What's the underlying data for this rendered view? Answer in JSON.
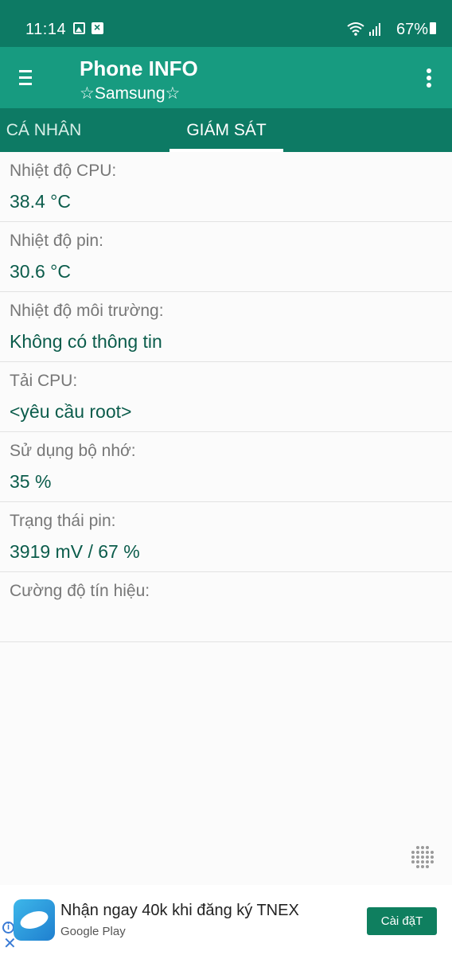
{
  "status_bar": {
    "time": "11:14",
    "battery_percent": "67%",
    "icons": [
      "image-icon",
      "x-notification-icon",
      "wifi-icon",
      "signal-icon",
      "battery-icon"
    ]
  },
  "app_bar": {
    "title": "Phone INFO",
    "subtitle": "☆Samsung☆"
  },
  "tabs": [
    {
      "label": "CÁ NHÂN"
    },
    {
      "label": "GIÁM SÁT",
      "active": true
    }
  ],
  "rows": [
    {
      "label": "Nhiệt độ CPU:",
      "value": "38.4 °C"
    },
    {
      "label": "Nhiệt độ pin:",
      "value": "30.6 °C"
    },
    {
      "label": "Nhiệt độ môi trường:",
      "value": "Không có thông tin"
    },
    {
      "label": "Tải CPU:",
      "value": "<yêu cầu root>"
    },
    {
      "label": "Sử dụng bộ nhớ:",
      "value": "35 %"
    },
    {
      "label": "Trạng thái pin:",
      "value": "3919 mV / 67 %"
    },
    {
      "label": "Cường độ tín hiệu:",
      "value": ""
    }
  ],
  "ad": {
    "title": "Nhận ngay 40k khi đăng ký TNEX",
    "source": "Google Play",
    "button_label": "Cài đặT",
    "info_glyph": "i",
    "close_glyph": "✕"
  },
  "colors": {
    "status_bar": "#0d7a64",
    "app_bar": "#179b80",
    "value_text": "#0b5c4b",
    "ad_button": "#0f7f5f"
  }
}
